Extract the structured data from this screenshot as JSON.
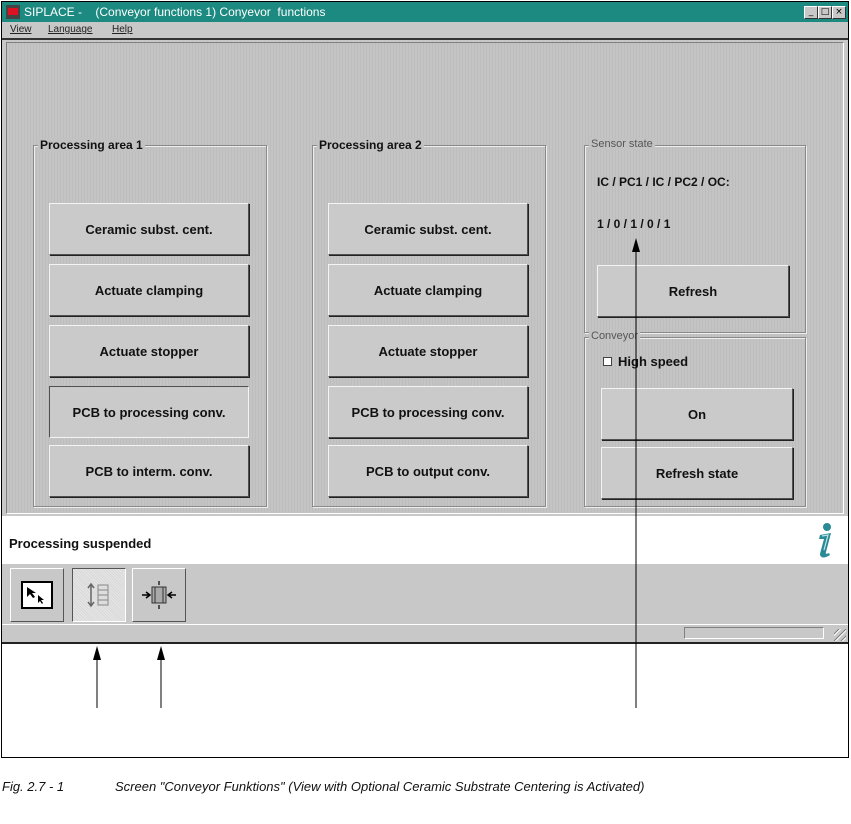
{
  "window": {
    "title": "SIPLACE -    (Conveyor functions 1) Conyevor  functions",
    "controls": {
      "minimize": "_",
      "maximize": "□",
      "close": "×"
    }
  },
  "menu": [
    "View",
    "Language",
    "Help"
  ],
  "area1": {
    "title": "Processing area 1",
    "buttons": [
      "Ceramic subst. cent.",
      "Actuate clamping",
      "Actuate stopper",
      "PCB to processing conv.",
      "PCB to interm. conv."
    ]
  },
  "area2": {
    "title": "Processing area 2",
    "buttons": [
      "Ceramic subst. cent.",
      "Actuate clamping",
      "Actuate stopper",
      "PCB to processing conv.",
      "PCB to output conv."
    ]
  },
  "sensor": {
    "title": "Sensor state",
    "label": "IC / PC1 / IC / PC2 / OC:",
    "value": "1 / 0 / 1 / 0 / 1",
    "refresh": "Refresh"
  },
  "conveyor": {
    "title": "Conveyor",
    "high_speed_label": "High speed",
    "high_speed_checked": false,
    "on": "On",
    "refresh_state": "Refresh state"
  },
  "status": {
    "text": "Processing suspended"
  },
  "toolbar": {
    "icons": [
      "pointer-icon",
      "conveyor-icon",
      "ceramic-centering-icon"
    ],
    "active_index": 1
  },
  "caption": {
    "label": "Fig. 2.7 - 1",
    "text": "Screen \"Conveyor Funktions\" (View with Optional Ceramic Substrate Centering is Activated)"
  }
}
